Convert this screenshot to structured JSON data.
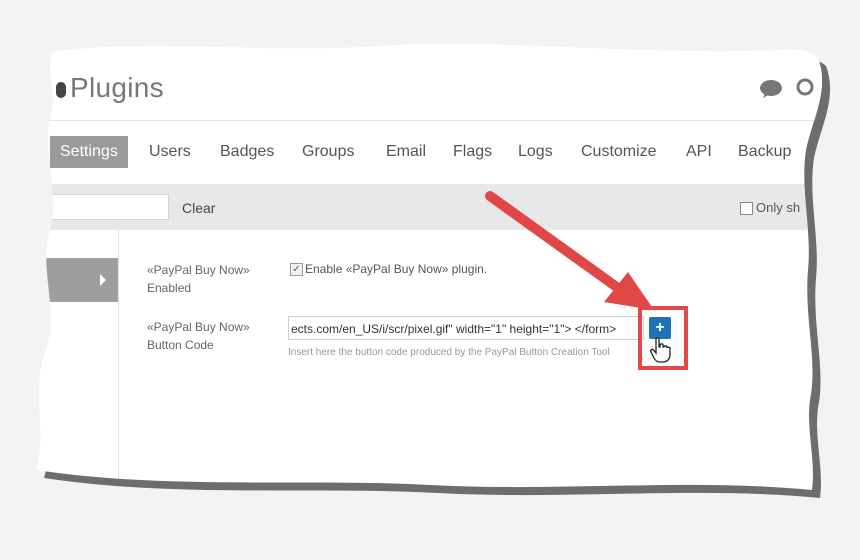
{
  "app": {
    "title": "Plugins"
  },
  "nav": {
    "tabs": [
      {
        "label": "Settings",
        "active": true
      },
      {
        "label": "Users"
      },
      {
        "label": "Badges"
      },
      {
        "label": "Groups"
      },
      {
        "label": "Email"
      },
      {
        "label": "Flags"
      },
      {
        "label": "Logs"
      },
      {
        "label": "Customize"
      },
      {
        "label": "API"
      },
      {
        "label": "Backup"
      }
    ]
  },
  "toolbar": {
    "search_value": "",
    "clear_label": "Clear",
    "only_show_label": "Only sh"
  },
  "settings": {
    "enabled": {
      "label": "«PayPal Buy Now» Enabled",
      "checkbox_text": "Enable «PayPal Buy Now» plugin.",
      "checked": true
    },
    "button_code": {
      "label": "«PayPal Buy Now» Button Code",
      "value": "ects.com/en_US/i/scr/pixel.gif\" width=\"1\" height=\"1\"> </form>",
      "help": "Insert here the button code produced by the PayPal Button Creation Tool"
    }
  },
  "add_button": {
    "label": "+"
  },
  "icons": {
    "chat": "chat-bubble-icon",
    "search": "search-icon",
    "cursor": "hand-pointer-icon",
    "sidebar_arrow": "chevron-right-icon"
  },
  "colors": {
    "active_tab": "#9a9a9a",
    "add_button": "#1e73b8",
    "highlight": "#e54848"
  }
}
